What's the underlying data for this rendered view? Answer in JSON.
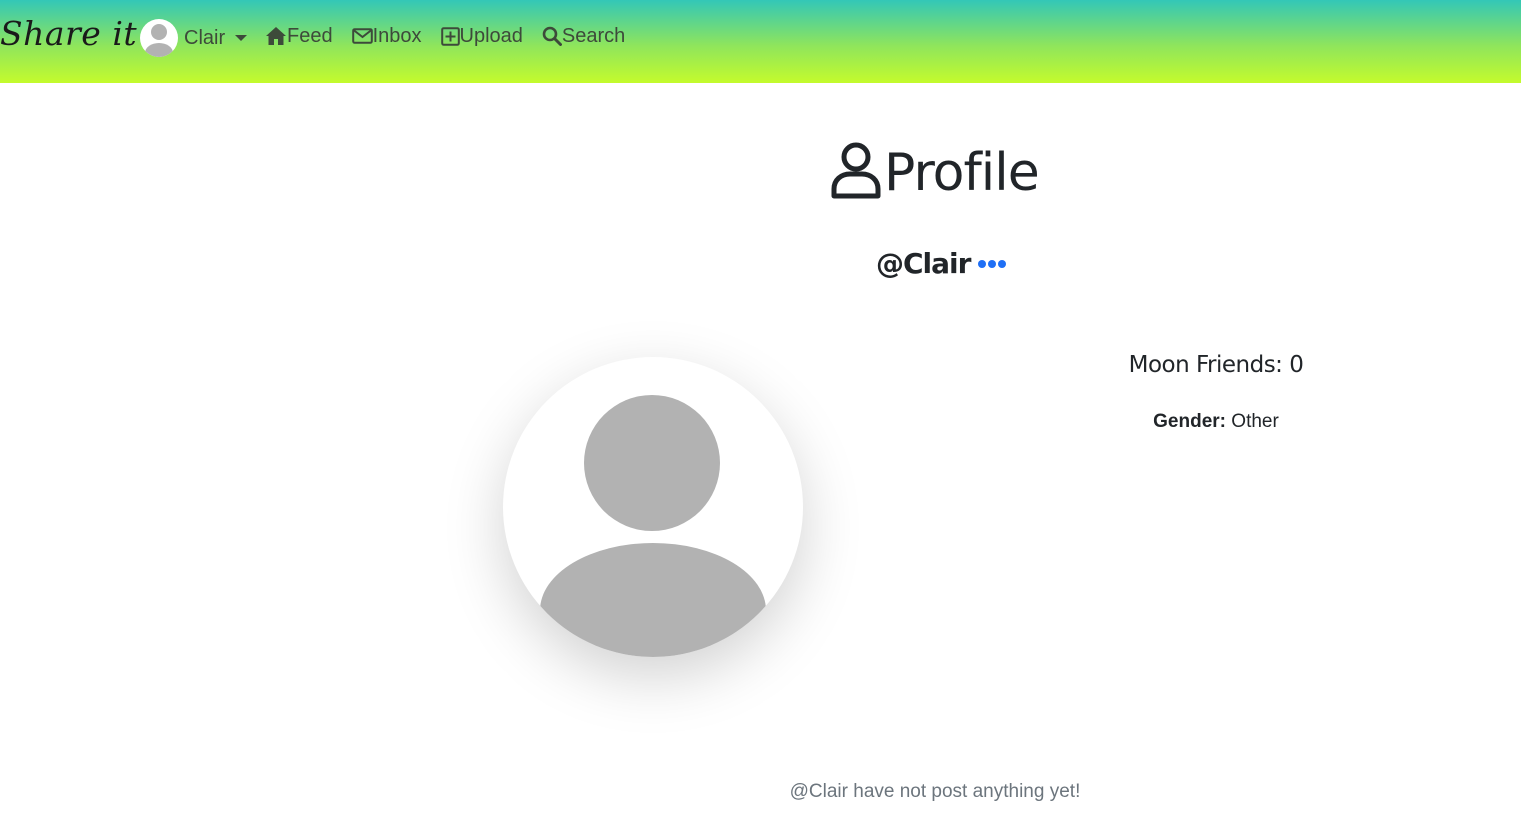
{
  "navbar": {
    "brand": "Share it",
    "user_name": "Clair",
    "links": [
      {
        "label": "Feed",
        "icon": "home-icon"
      },
      {
        "label": "Inbox",
        "icon": "envelope-icon"
      },
      {
        "label": "Upload",
        "icon": "plus-square-icon"
      },
      {
        "label": "Search",
        "icon": "search-icon"
      }
    ]
  },
  "profile": {
    "title": "Profile",
    "handle": "@Clair",
    "friends_text": "Moon Friends: 0",
    "gender_label": "Gender:",
    "gender_value": "Other",
    "empty_message": "@Clair have not post anything yet!"
  },
  "colors": {
    "gradient_top": "#33c7b7",
    "gradient_bottom": "#c4fb2c",
    "accent_dots": "#1f6ff5",
    "avatar_placeholder": "#b2b2b2"
  }
}
